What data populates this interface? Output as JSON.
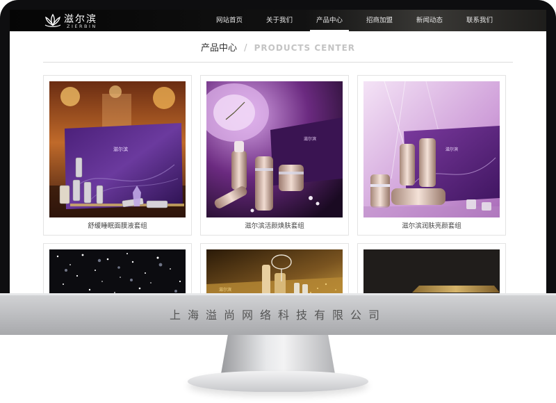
{
  "site": {
    "logo_cn": "滋尔滨",
    "logo_en": "ZIERBIN"
  },
  "nav": {
    "items": [
      {
        "label": "网站首页"
      },
      {
        "label": "关于我们"
      },
      {
        "label": "产品中心"
      },
      {
        "label": "招商加盟"
      },
      {
        "label": "新闻动态"
      },
      {
        "label": "联系我们"
      }
    ],
    "active_index": 2
  },
  "section": {
    "title_cn": "产品中心",
    "separator": "/",
    "title_en": "PRODUCTS CENTER"
  },
  "products": [
    {
      "caption": "舒缓睡眠面膜液套组",
      "scene": "purple-box-chandelier"
    },
    {
      "caption": "滋尔滨活颜焕肤套组",
      "scene": "violet-clock-bottles"
    },
    {
      "caption": "滋尔滨润肤亮颜套组",
      "scene": "lavender-box-bottles"
    },
    {
      "caption": "",
      "scene": "black-sparkle"
    },
    {
      "caption": "",
      "scene": "gold-glass-set"
    },
    {
      "caption": "",
      "scene": "dark-gold-pouch"
    }
  ],
  "monitor": {
    "company": "上海溢尚网络科技有限公司"
  },
  "colors": {
    "nav_bg": "#0a0a0a",
    "accent_purple": "#5b2b86",
    "text_dark": "#333333"
  }
}
